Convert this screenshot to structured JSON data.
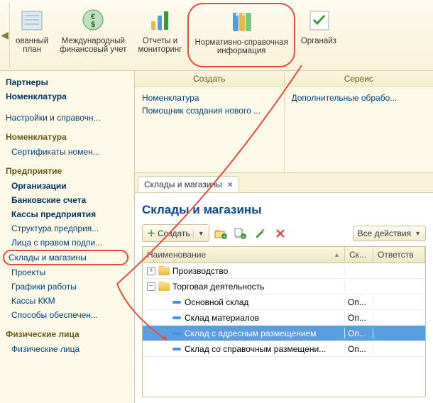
{
  "toolbar": {
    "items": [
      {
        "label": "ованный\nплан",
        "name": "toolbar-plan"
      },
      {
        "label": "Международный\nфинансовый учет",
        "name": "toolbar-intl-finance"
      },
      {
        "label": "Отчеты и\nмониторинг",
        "name": "toolbar-reports"
      },
      {
        "label": "Нормативно-справочная\nинформация",
        "name": "toolbar-reference-info",
        "highlighted": true
      },
      {
        "label": "Органайз",
        "name": "toolbar-organizer"
      }
    ]
  },
  "sidebar": {
    "top": [
      {
        "label": "Партнеры",
        "bold": true
      },
      {
        "label": "Номенклатура",
        "bold": true
      }
    ],
    "topExtra": [
      {
        "label": "Настройки и справочн..."
      }
    ],
    "sections": [
      {
        "title": "Номенклатура",
        "items": [
          {
            "label": "Сертификаты номен..."
          }
        ]
      },
      {
        "title": "Предприятие",
        "items": [
          {
            "label": "Организации",
            "bold": true
          },
          {
            "label": "Банковские счета",
            "bold": true
          },
          {
            "label": "Кассы предприятия",
            "bold": true
          },
          {
            "label": "Структура предприя..."
          },
          {
            "label": "Лица с правом подпи..."
          },
          {
            "label": "Склады и магазины",
            "selected": true
          },
          {
            "label": "Проекты"
          },
          {
            "label": "Графики работы"
          },
          {
            "label": "Кассы ККМ"
          },
          {
            "label": "Способы обеспечен..."
          }
        ]
      },
      {
        "title": "Физические лица",
        "items": [
          {
            "label": "Физические лица"
          }
        ]
      }
    ]
  },
  "panels": {
    "create": {
      "title": "Создать",
      "items": [
        "Номенклатура",
        "Помощник создания нового ..."
      ]
    },
    "service": {
      "title": "Сервис",
      "items": [
        "Дополнительные обрабо..."
      ]
    }
  },
  "tab": {
    "label": "Склады и магазины"
  },
  "page": {
    "title": "Склады и магазины",
    "create_label": "Создать",
    "all_actions_label": "Все действия"
  },
  "table": {
    "columns": {
      "name": "Наименование",
      "sk": "Ск...",
      "otv": "Ответств"
    },
    "rows": [
      {
        "type": "folder",
        "level": 0,
        "expand": "plus",
        "label": "Производство",
        "sk": "",
        "otv": ""
      },
      {
        "type": "folder",
        "level": 0,
        "expand": "minus",
        "label": "Торговая деятельность",
        "sk": "",
        "otv": ""
      },
      {
        "type": "item",
        "level": 1,
        "expand": "empty",
        "label": "Основной склад",
        "sk": "Оп...",
        "otv": ""
      },
      {
        "type": "item",
        "level": 1,
        "expand": "empty",
        "label": "Склад материалов",
        "sk": "Оп...",
        "otv": ""
      },
      {
        "type": "item",
        "level": 1,
        "expand": "empty",
        "label": "Склад с адресным размещением",
        "sk": "Оп...",
        "otv": "",
        "highlighted": true
      },
      {
        "type": "item",
        "level": 1,
        "expand": "empty",
        "label": "Склад со справочным размещени...",
        "sk": "Оп...",
        "otv": ""
      }
    ]
  }
}
